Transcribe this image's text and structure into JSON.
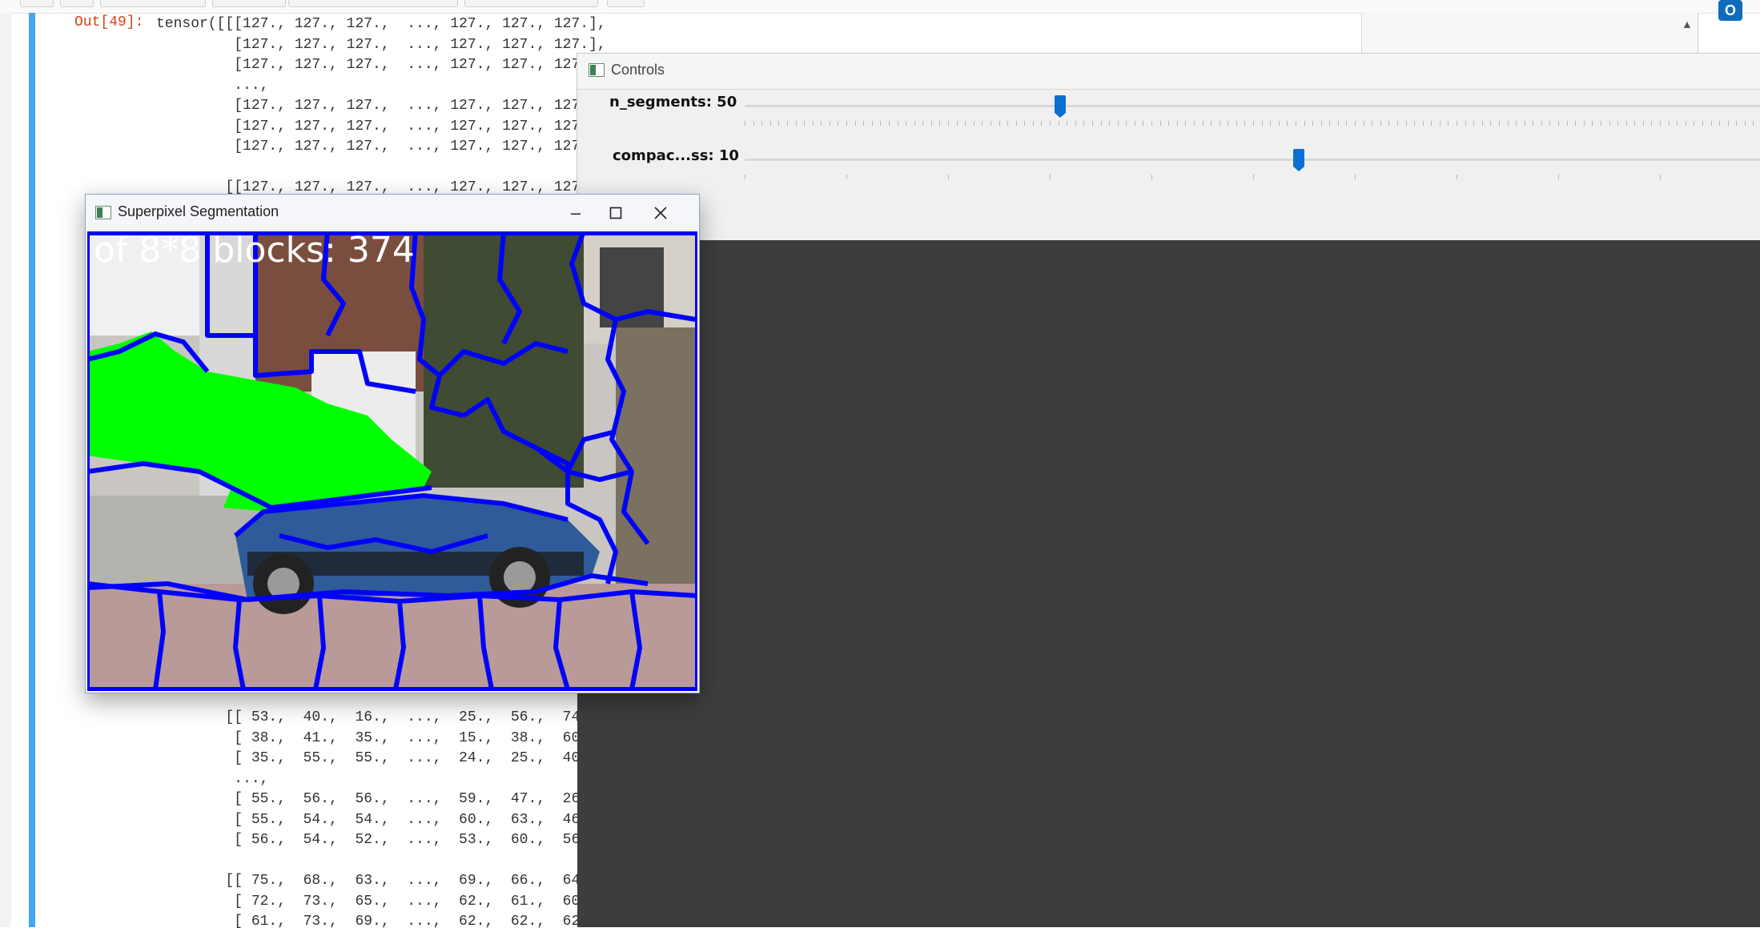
{
  "notebook": {
    "out_prompt": "Out[49]:",
    "lines_top": [
      "tensor([[[127., 127., 127.,  ..., 127., 127., 127.],",
      "         [127., 127., 127.,  ..., 127., 127., 127.],",
      "         [127., 127., 127.,  ..., 127., 127., 127.",
      "         ...,",
      "         [127., 127., 127.,  ..., 127., 127., 127.",
      "         [127., 127., 127.,  ..., 127., 127., 127.",
      "         [127., 127., 127.,  ..., 127., 127., 127.",
      "",
      "        [[127., 127., 127.,  ..., 127., 127., 127."
    ],
    "lines_bottom": [
      "        [[ 53.,  40.,  16.,  ...,  25.,  56.,  74.",
      "         [ 38.,  41.,  35.,  ...,  15.,  38.,  60.",
      "         [ 35.,  55.,  55.,  ...,  24.,  25.,  40.",
      "         ...,",
      "         [ 55.,  56.,  56.,  ...,  59.,  47.,  26.",
      "         [ 55.,  54.,  54.,  ...,  60.,  63.,  46.",
      "         [ 56.,  54.,  52.,  ...,  53.,  60.,  56.",
      "",
      "        [[ 75.,  68.,  63.,  ...,  69.,  66.,  64.",
      "         [ 72.,  73.,  65.,  ...,  62.,  61.,  60.",
      "         [ 61.,  73.,  69.,  ...,  62.,  62.,  62."
    ]
  },
  "controls_window": {
    "title": "Controls",
    "trackbars": [
      {
        "label": "n_segments: 50",
        "value": 50,
        "fraction": 0.31
      },
      {
        "label": "compac...ss: 10",
        "value": 10,
        "fraction": 0.545
      }
    ]
  },
  "superpixel_window": {
    "title": "Superpixel Segmentation",
    "overlay_text": "of 8*8 blocks: 374",
    "boundary_color": "#0000ff",
    "highlight_color": "#00ff00"
  },
  "icons": [
    "window-app-icon",
    "minimize-icon",
    "maximize-icon",
    "close-icon",
    "outlook-icon",
    "scroll-up-icon"
  ],
  "colors": {
    "accent": "#0a6fd2",
    "cell_bar": "#42a5f5",
    "dark_canvas": "#3d3d3d"
  }
}
